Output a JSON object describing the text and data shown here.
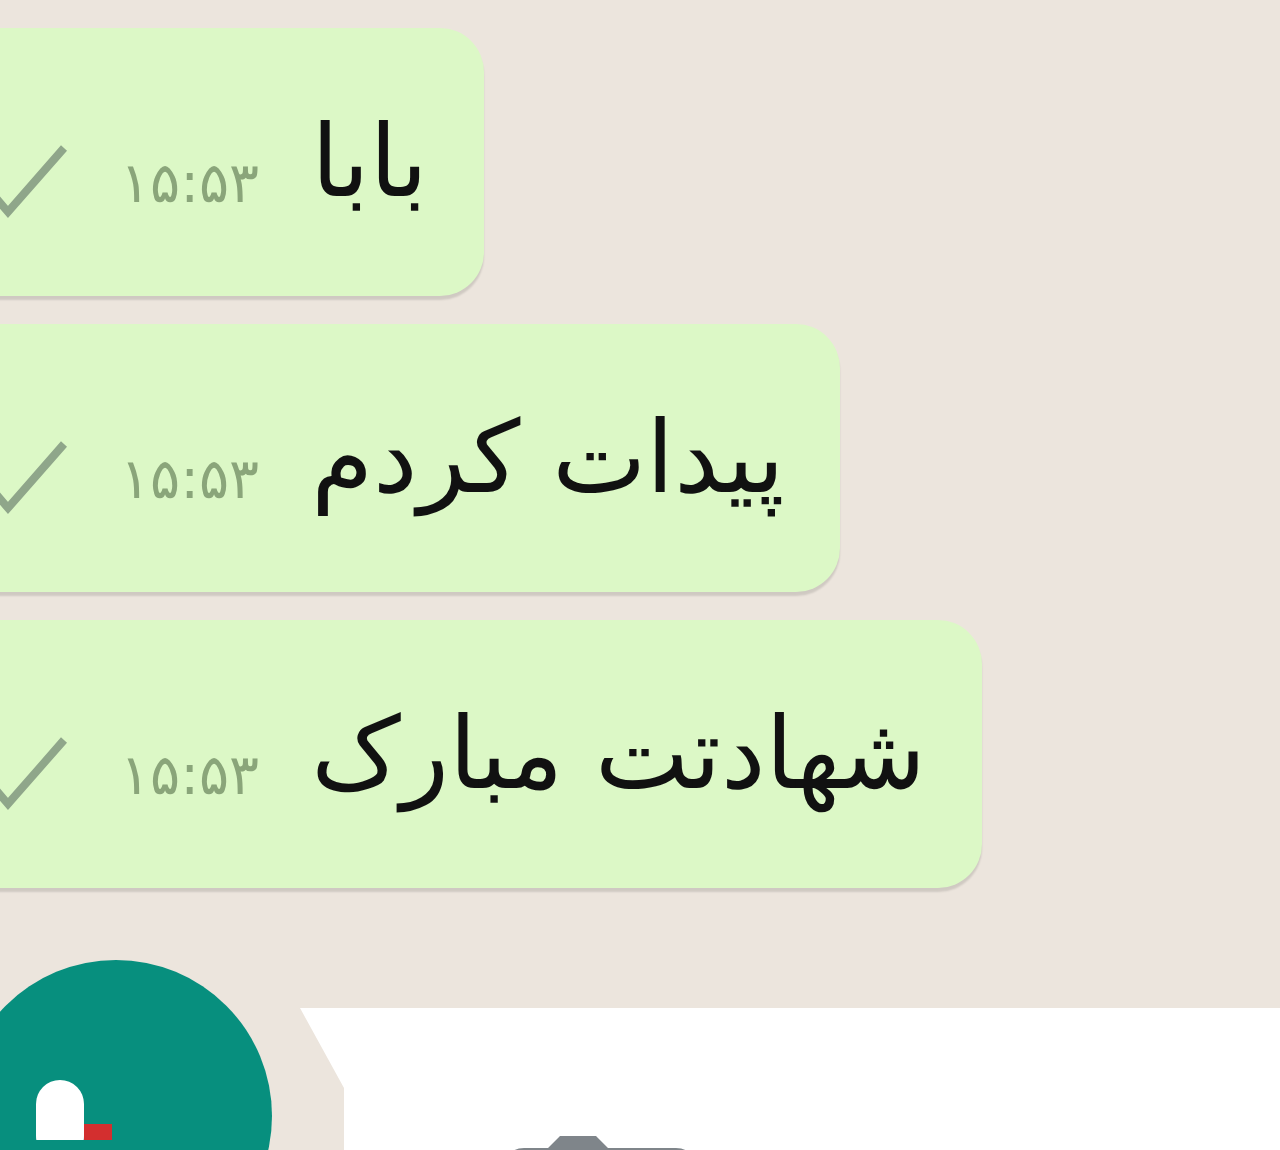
{
  "messages": [
    {
      "text": "بابا",
      "time": "۱۵:۵۳",
      "delivered": false
    },
    {
      "text": "پیدات کردم",
      "time": "۱۵:۵۳",
      "delivered": false
    },
    {
      "text": "شهادتت مبارک",
      "time": "۱۵:۵۳",
      "delivered": false
    }
  ]
}
